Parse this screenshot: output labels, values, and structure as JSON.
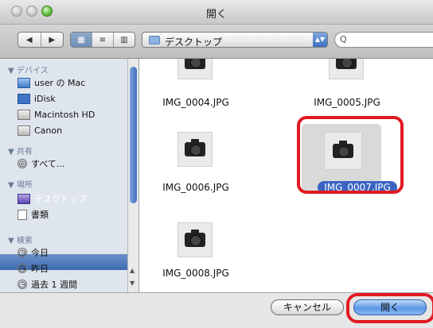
{
  "window": {
    "title": "開く"
  },
  "toolbar": {
    "back_icon": "◀",
    "forward_icon": "▶",
    "view_icons": [
      "▦",
      "≡",
      "▥"
    ],
    "path_label": "デスクトップ",
    "path_arrows": "▲▼",
    "search_icon": "Q",
    "search_value": ""
  },
  "sidebar": {
    "sections": [
      {
        "header": "▼ デバイス",
        "items": [
          "user の Mac",
          "iDisk",
          "Macintosh HD",
          "Canon"
        ]
      },
      {
        "header": "▼ 共有",
        "items": [
          "すべて..."
        ]
      },
      {
        "header": "▼ 場所",
        "items": [
          "デスクトップ",
          "書類"
        ]
      },
      {
        "header": "▼ 検索",
        "items": [
          "今日",
          "昨日",
          "過去 1 週間"
        ]
      }
    ],
    "selected_item": "デスクトップ",
    "scroll_up": "▲",
    "scroll_down": "▼"
  },
  "files": [
    {
      "name": "IMG_0004.JPG",
      "selected": false
    },
    {
      "name": "IMG_0005.JPG",
      "selected": false
    },
    {
      "name": "IMG_0006.JPG",
      "selected": false
    },
    {
      "name": "IMG_0007.JPG",
      "selected": true
    },
    {
      "name": "IMG_0008.JPG",
      "selected": false
    }
  ],
  "footer": {
    "cancel_label": "キャンセル",
    "open_label": "開く"
  },
  "colors": {
    "highlight_red": "#e11a22",
    "selection_blue": "#3a64c2",
    "sidebar_bg": "#dfe5ed"
  }
}
